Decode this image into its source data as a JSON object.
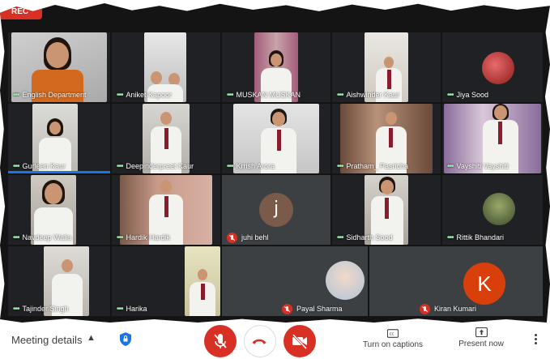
{
  "recording_badge": "REC",
  "participants": [
    {
      "name": "English Department",
      "status": "active"
    },
    {
      "name": "Aniket Kapoor",
      "status": "active"
    },
    {
      "name": "MUSKAN MUSKAN",
      "status": "active"
    },
    {
      "name": "Aishwinder Kaur",
      "status": "active"
    },
    {
      "name": "Jiya Sood",
      "status": "active"
    },
    {
      "name": "Gurleen Kaur",
      "status": "speaking"
    },
    {
      "name": "Deepinderpreet Kaur",
      "status": "active"
    },
    {
      "name": "Krrish Arora",
      "status": "active"
    },
    {
      "name": "Pratham_ Pasricha",
      "status": "active"
    },
    {
      "name": "Vayshiti Vayshiti",
      "status": "active"
    },
    {
      "name": "Navdeep Walia",
      "status": "active"
    },
    {
      "name": "Hardik Hardik",
      "status": "active"
    },
    {
      "name": "juhi behl",
      "status": "muted",
      "initial": "j"
    },
    {
      "name": "Sidharth Sood",
      "status": "active"
    },
    {
      "name": "Rittik Bhandari",
      "status": "active"
    },
    {
      "name": "Tajinder Singh",
      "status": "active"
    },
    {
      "name": "Harika",
      "status": "active"
    },
    {
      "name": "Payal Sharma",
      "status": "muted"
    },
    {
      "name": "Kiran Kumari",
      "status": "muted",
      "initial": "K"
    }
  ],
  "toolbar": {
    "meeting_details": "Meeting details",
    "meeting_details_icon": "chevron-up-icon",
    "security_icon": "shield-lock-icon",
    "mic_icon": "mic-off-icon",
    "hangup_icon": "call-end-icon",
    "camera_icon": "camera-off-icon",
    "captions": "Turn on captions",
    "present": "Present now",
    "more_icon": "more-vert-icon"
  },
  "colors": {
    "muted_red": "#d93025",
    "speaking_green": "#8ee8a0",
    "active_bar": "#1a73e8",
    "tile_bg": "#3c4043",
    "kiran_avatar": "#d93f0b",
    "juhi_avatar": "#7a5a48"
  }
}
